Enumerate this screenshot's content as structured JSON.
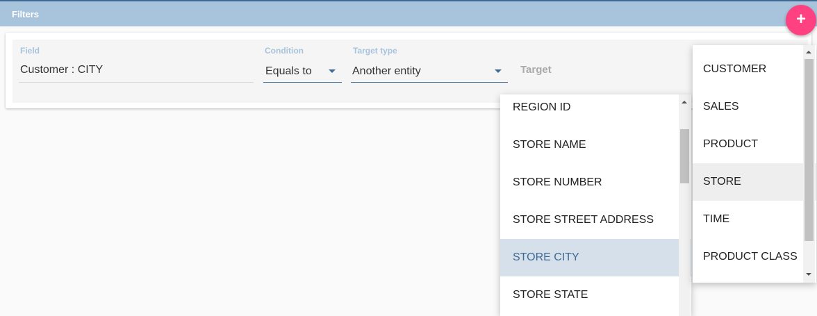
{
  "header": {
    "title": "Filters",
    "add_symbol": "+"
  },
  "filter": {
    "field_label": "Field",
    "field_value": "Customer : CITY",
    "condition_label": "Condition",
    "condition_value": "Equals to",
    "target_type_label": "Target type",
    "target_type_value": "Another entity",
    "target_placeholder": "Target"
  },
  "field_menu": {
    "items": [
      "REGION ID",
      "STORE NAME",
      "STORE NUMBER",
      "STORE STREET ADDRESS",
      "STORE CITY",
      "STORE STATE"
    ],
    "highlighted": "STORE CITY"
  },
  "entity_menu": {
    "items": [
      "CUSTOMER",
      "SALES",
      "PRODUCT",
      "STORE",
      "TIME",
      "PRODUCT CLASS"
    ],
    "selected": "STORE"
  },
  "colors": {
    "accent": "#3f6a94",
    "header": "#a8c3dc",
    "fab": "#ff4081",
    "highlight": "#d5e0ea"
  },
  "icons": {
    "add": "plus-icon",
    "dropdown": "caret-down-icon"
  }
}
